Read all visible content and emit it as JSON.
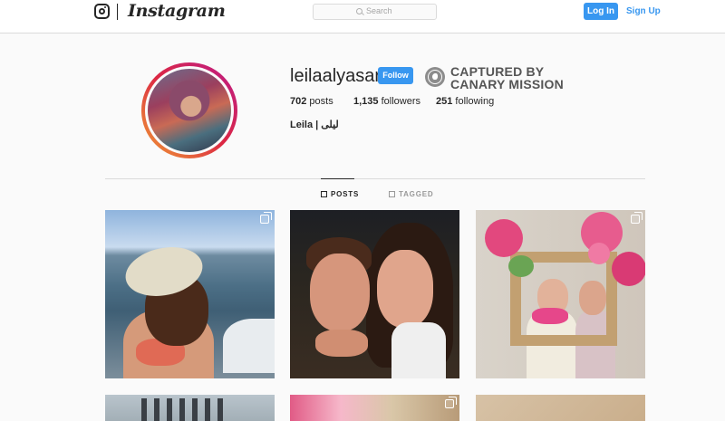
{
  "header": {
    "brand": "Instagram",
    "search_placeholder": "Search",
    "login_label": "Log In",
    "signup_label": "Sign Up"
  },
  "profile": {
    "username": "leilaalyasari",
    "follow_label": "Follow",
    "stamp_line1": "CAPTURED BY",
    "stamp_line2": "CANARY MISSION",
    "posts_count": "702",
    "posts_label": "posts",
    "followers_count": "1,135",
    "followers_label": "followers",
    "following_count": "251",
    "following_label": "following",
    "full_name": "Leila | ليلى"
  },
  "tabs": [
    {
      "label": "POSTS",
      "active": true
    },
    {
      "label": "TAGGED",
      "active": false
    }
  ],
  "colors": {
    "accent": "#3897f0",
    "text": "#262626",
    "muted": "#999999",
    "border": "#dbdbdb",
    "background": "#fafafa"
  },
  "icons": {
    "logo": "instagram-camera-icon",
    "search": "search-icon",
    "stamp": "canary-bird-icon",
    "posts_tab": "grid-icon",
    "tagged_tab": "tag-portrait-icon",
    "multi_photo": "carousel-icon"
  }
}
